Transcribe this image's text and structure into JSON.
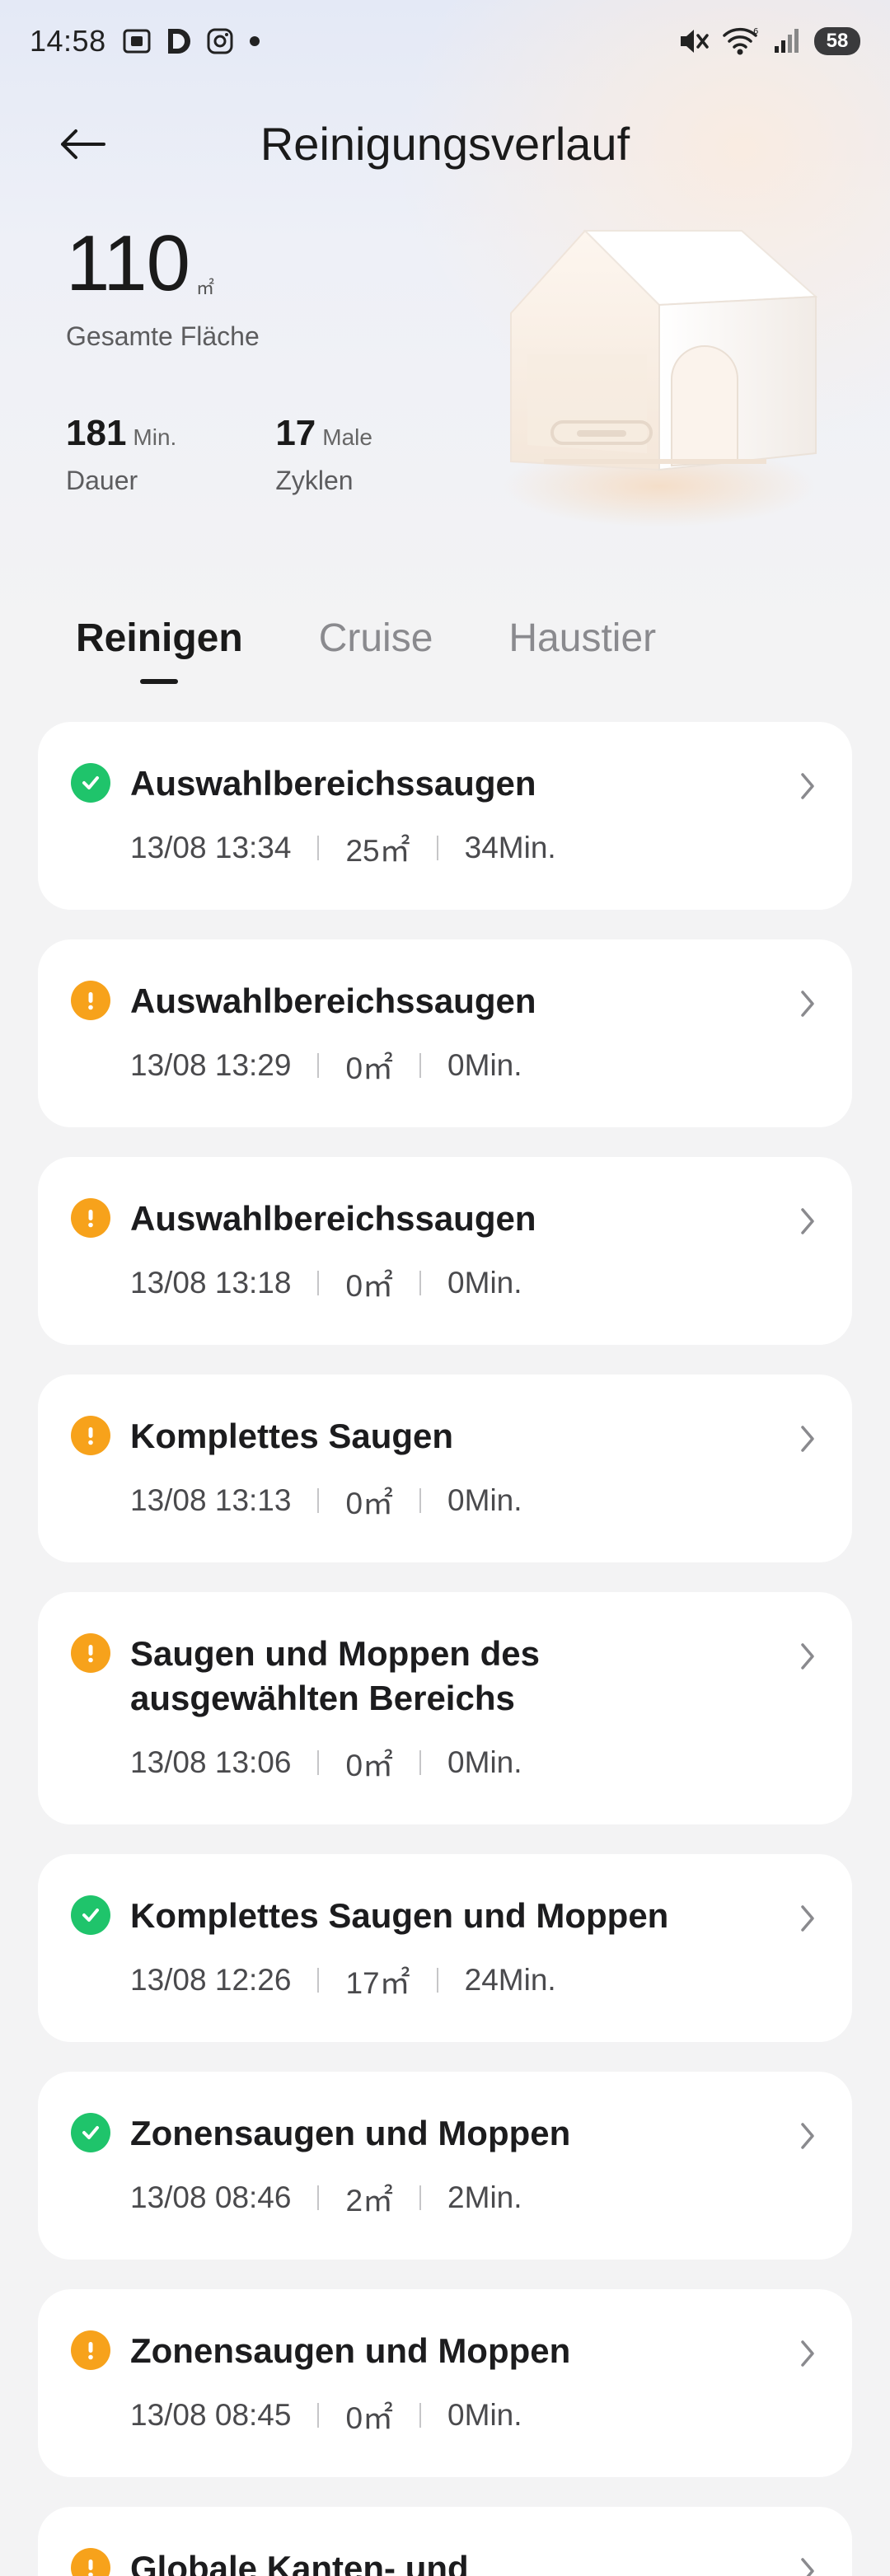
{
  "status_bar": {
    "time": "14:58",
    "battery": "58",
    "icons_left": [
      "screenshot-icon",
      "d-app-icon",
      "instagram-icon",
      "dot-icon"
    ],
    "icons_right": [
      "mute-icon",
      "wifi-icon",
      "signal-icon",
      "battery-icon"
    ]
  },
  "header": {
    "title": "Reinigungsverlauf"
  },
  "stats": {
    "total_area": "110",
    "total_area_unit": "㎡",
    "total_area_label": "Gesamte Fläche",
    "duration_value": "181",
    "duration_unit": "Min.",
    "duration_label": "Dauer",
    "cycles_value": "17",
    "cycles_unit": "Male",
    "cycles_label": "Zyklen"
  },
  "tabs": [
    {
      "label": "Reinigen",
      "active": true
    },
    {
      "label": "Cruise",
      "active": false
    },
    {
      "label": "Haustier",
      "active": false
    }
  ],
  "records": [
    {
      "title": "Auswahlbereichssaugen",
      "status": "ok",
      "datetime": "13/08 13:34",
      "area": "25",
      "area_unit": "㎡",
      "duration": "34Min."
    },
    {
      "title": "Auswahlbereichssaugen",
      "status": "warn",
      "datetime": "13/08 13:29",
      "area": "0",
      "area_unit": "㎡",
      "duration": "0Min."
    },
    {
      "title": "Auswahlbereichssaugen",
      "status": "warn",
      "datetime": "13/08 13:18",
      "area": "0",
      "area_unit": "㎡",
      "duration": "0Min."
    },
    {
      "title": "Komplettes Saugen",
      "status": "warn",
      "datetime": "13/08 13:13",
      "area": "0",
      "area_unit": "㎡",
      "duration": "0Min."
    },
    {
      "title": "Saugen und Moppen des ausgewählten Bereichs",
      "status": "warn",
      "datetime": "13/08 13:06",
      "area": "0",
      "area_unit": "㎡",
      "duration": "0Min."
    },
    {
      "title": "Komplettes Saugen und Moppen",
      "status": "ok",
      "datetime": "13/08 12:26",
      "area": "17",
      "area_unit": "㎡",
      "duration": "24Min."
    },
    {
      "title": "Zonensaugen und Moppen",
      "status": "ok",
      "datetime": "13/08 08:46",
      "area": "2",
      "area_unit": "㎡",
      "duration": "2Min."
    },
    {
      "title": "Zonensaugen und Moppen",
      "status": "warn",
      "datetime": "13/08 08:45",
      "area": "0",
      "area_unit": "㎡",
      "duration": "0Min."
    },
    {
      "title": "Globale Kanten- und",
      "status": "warn",
      "datetime": "",
      "area": "",
      "area_unit": "",
      "duration": ""
    }
  ],
  "colors": {
    "ok": "#1fc46b",
    "warn": "#f7a21b",
    "card": "#ffffff",
    "background": "#f3f3f4"
  }
}
